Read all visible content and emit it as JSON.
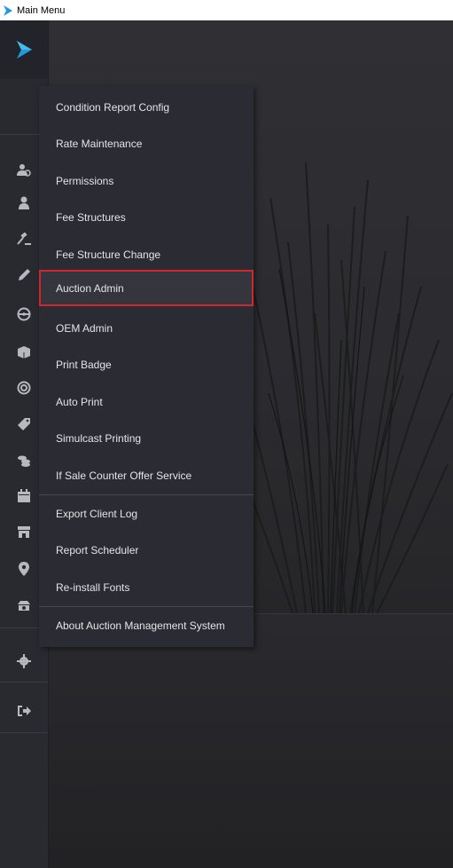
{
  "window": {
    "title": "Main Menu"
  },
  "colors": {
    "sidebar": "#292a30",
    "menu_bg": "#2b2c33",
    "highlight_border": "#d0262e",
    "logo_blue": "#1e9be0"
  },
  "sidebar": {
    "icons": [
      "user-group-icon",
      "user-icon",
      "gavel-icon",
      "pencil-icon",
      "steering-wheel-icon",
      "package-icon",
      "target-icon",
      "tag-icon",
      "coins-icon",
      "calendar-icon",
      "storefront-icon",
      "location-pin-icon",
      "car-wash-icon",
      "gear-icon",
      "sign-out-icon"
    ]
  },
  "menu": {
    "items": [
      {
        "label": "Condition Report Config"
      },
      {
        "label": "Rate Maintenance"
      },
      {
        "label": "Permissions"
      },
      {
        "label": "Fee Structures"
      },
      {
        "label": "Fee Structure Change"
      },
      {
        "label": "Auction Admin",
        "highlighted": true
      },
      {
        "label": "OEM Admin"
      },
      {
        "label": "Print Badge"
      },
      {
        "label": "Auto Print"
      },
      {
        "label": "Simulcast Printing"
      },
      {
        "label": "If Sale Counter Offer Service"
      },
      {
        "label": "Export Client Log"
      },
      {
        "label": "Report Scheduler"
      },
      {
        "label": "Re-install Fonts"
      },
      {
        "label": "About Auction Management System"
      }
    ]
  }
}
